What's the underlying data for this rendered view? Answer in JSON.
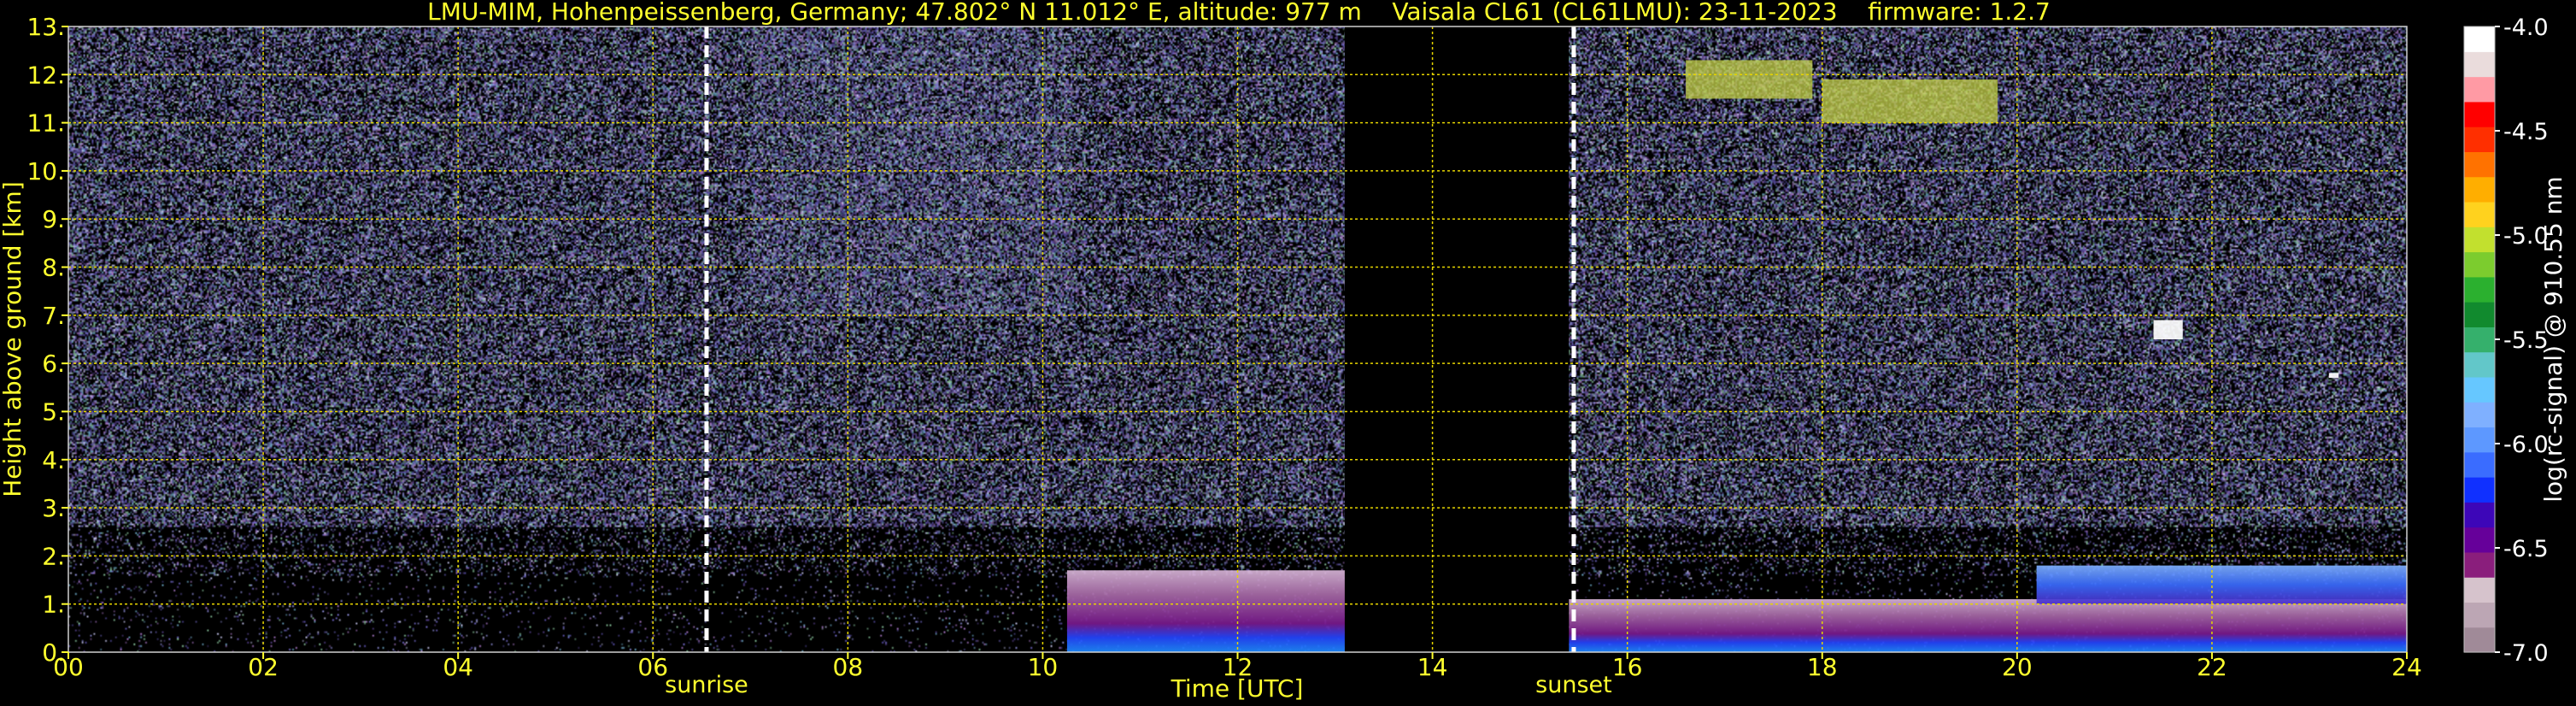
{
  "chart_data": {
    "type": "heatmap",
    "title": "LMU-MIM, Hohenpeissenberg, Germany; 47.802° N 11.012° E, altitude: 977 m    Vaisala CL61 (CL61LMU): 23-11-2023    firmware: 1.2.7",
    "xlabel": "Time [UTC]",
    "ylabel": "Height above ground [km]",
    "xlim": [
      0,
      24
    ],
    "ylim": [
      0,
      13
    ],
    "x_ticks": [
      "00",
      "02",
      "04",
      "06",
      "08",
      "10",
      "12",
      "14",
      "16",
      "18",
      "20",
      "22",
      "24"
    ],
    "y_ticks": [
      "0.",
      "1.",
      "2.",
      "3.",
      "4.",
      "5.",
      "6.",
      "7.",
      "8.",
      "9.",
      "10.",
      "11.",
      "12.",
      "13."
    ],
    "grid": true,
    "colorbar": {
      "label": "log(rc-signal) @ 910.55 nm",
      "range": [
        -7.0,
        -4.0
      ],
      "ticks": [
        "-7.0",
        "-6.5",
        "-6.0",
        "-5.5",
        "-5.0",
        "-4.5",
        "-4.0"
      ],
      "colors": [
        "#a08a98",
        "#bca6b4",
        "#d6c3cc",
        "#8a1e7c",
        "#66009a",
        "#3d06b8",
        "#1030ff",
        "#3a6cff",
        "#5d98ff",
        "#7fb0ff",
        "#66c7ff",
        "#62c7c9",
        "#35b06c",
        "#118a2e",
        "#2bb02f",
        "#7ccc2e",
        "#c2e02e",
        "#ffd21e",
        "#ffae00",
        "#ff7200",
        "#ff2f00",
        "#ff0000",
        "#ff9aa4",
        "#eadcdc",
        "#ffffff"
      ]
    },
    "events": [
      {
        "name": "sunrise",
        "time": 6.55
      },
      {
        "name": "sunset",
        "time": 15.45
      }
    ],
    "data_gap": [
      13.1,
      15.4
    ],
    "features": [
      {
        "feature": "boundary layer aerosol",
        "t0": 10.25,
        "t1": 13.1,
        "h0": 0.0,
        "h1": 1.7
      },
      {
        "feature": "boundary layer aerosol",
        "t0": 15.4,
        "t1": 24.0,
        "h0": 0.0,
        "h1": 1.1
      },
      {
        "feature": "elevated aerosol layer",
        "t0": 20.2,
        "t1": 24.0,
        "h0": 1.0,
        "h1": 1.8
      },
      {
        "feature": "cirrus",
        "t0": 16.6,
        "t1": 17.9,
        "h0": 11.5,
        "h1": 12.3
      },
      {
        "feature": "cirrus",
        "t0": 18.0,
        "t1": 19.8,
        "h0": 11.0,
        "h1": 11.9
      },
      {
        "feature": "cloud",
        "t0": 21.4,
        "t1": 21.7,
        "h0": 6.5,
        "h1": 6.9
      },
      {
        "feature": "cloud",
        "t0": 23.2,
        "t1": 23.3,
        "h0": 5.7,
        "h1": 5.8
      }
    ]
  }
}
